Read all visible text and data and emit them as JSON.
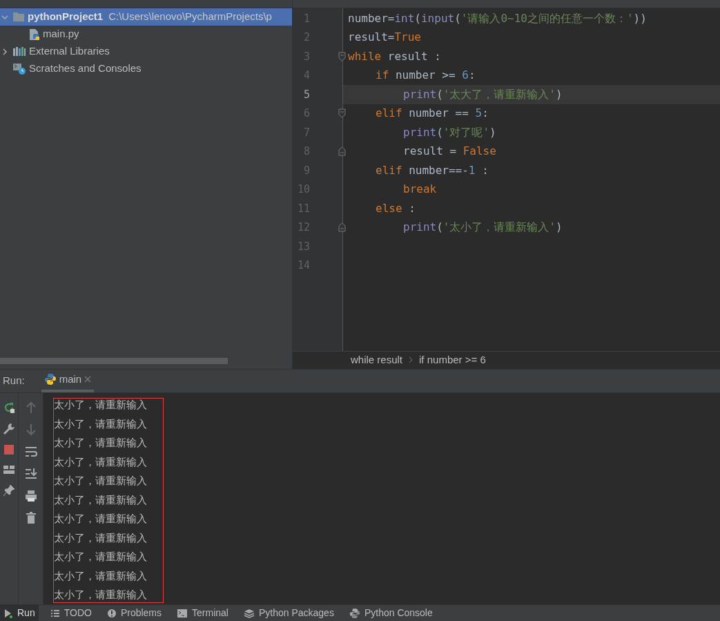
{
  "project_tree": [
    {
      "label": "pythonProject1",
      "path": "C:\\Users\\lenovo\\PycharmProjects\\p",
      "kind": "folder",
      "expanded": true,
      "selected": true,
      "children": [
        {
          "label": "main.py",
          "kind": "python",
          "selected": false
        }
      ]
    },
    {
      "label": "External Libraries",
      "kind": "library",
      "expanded": false,
      "selected": false
    },
    {
      "label": "Scratches and Consoles",
      "kind": "scratches",
      "selected": false
    }
  ],
  "editor": {
    "lines": [
      {
        "number": "1",
        "current": false,
        "tokens": [
          {
            "text": "number",
            "kind": "plain"
          },
          {
            "text": "=",
            "kind": "plain"
          },
          {
            "text": "int",
            "kind": "builtin"
          },
          {
            "text": "(",
            "kind": "plain"
          },
          {
            "text": "input",
            "kind": "builtin"
          },
          {
            "text": "(",
            "kind": "plain"
          },
          {
            "text": "'请输入0~10之间的任意一个数：'",
            "kind": "string"
          },
          {
            "text": "))",
            "kind": "plain"
          }
        ]
      },
      {
        "number": "2",
        "current": false,
        "tokens": [
          {
            "text": "result=",
            "kind": "plain"
          },
          {
            "text": "True",
            "kind": "keyword"
          }
        ]
      },
      {
        "number": "3",
        "current": false,
        "fold_start": true,
        "tokens": [
          {
            "text": "while",
            "kind": "keyword"
          },
          {
            "text": " result :",
            "kind": "plain"
          }
        ],
        "children": [
          {
            "number": "4",
            "current": false,
            "tokens": [
              {
                "text": "if",
                "kind": "keyword"
              },
              {
                "text": " number >= ",
                "kind": "plain"
              },
              {
                "text": "6",
                "kind": "number"
              },
              {
                "text": ":",
                "kind": "plain"
              }
            ],
            "children": [
              {
                "number": "5",
                "current": true,
                "tokens": [
                  {
                    "text": "print",
                    "kind": "builtin"
                  },
                  {
                    "text": "(",
                    "kind": "plain"
                  },
                  {
                    "text": "'太大了，请重新输入'",
                    "kind": "string"
                  },
                  {
                    "text": ")",
                    "kind": "plain"
                  }
                ]
              }
            ]
          },
          {
            "number": "6",
            "current": false,
            "fold_start": true,
            "tokens": [
              {
                "text": "elif",
                "kind": "keyword"
              },
              {
                "text": " number == ",
                "kind": "plain"
              },
              {
                "text": "5",
                "kind": "number"
              },
              {
                "text": ":",
                "kind": "plain"
              }
            ],
            "children": [
              {
                "number": "7",
                "current": false,
                "tokens": [
                  {
                    "text": "print",
                    "kind": "builtin"
                  },
                  {
                    "text": "(",
                    "kind": "plain"
                  },
                  {
                    "text": "'对了呢'",
                    "kind": "string"
                  },
                  {
                    "text": ")",
                    "kind": "plain"
                  }
                ]
              },
              {
                "number": "8",
                "current": false,
                "fold_end": true,
                "tokens": [
                  {
                    "text": "result = ",
                    "kind": "plain"
                  },
                  {
                    "text": "False",
                    "kind": "keyword"
                  }
                ]
              }
            ]
          },
          {
            "number": "9",
            "current": false,
            "tokens": [
              {
                "text": "elif",
                "kind": "keyword"
              },
              {
                "text": " number==-",
                "kind": "plain"
              },
              {
                "text": "1",
                "kind": "number"
              },
              {
                "text": " :",
                "kind": "plain"
              }
            ],
            "children": [
              {
                "number": "10",
                "current": false,
                "tokens": [
                  {
                    "text": "break",
                    "kind": "keyword"
                  }
                ]
              }
            ]
          },
          {
            "number": "11",
            "current": false,
            "tokens": [
              {
                "text": "else",
                "kind": "keyword"
              },
              {
                "text": " :",
                "kind": "plain"
              }
            ],
            "children": [
              {
                "number": "12",
                "current": false,
                "fold_end": true,
                "tokens": [
                  {
                    "text": "print",
                    "kind": "builtin"
                  },
                  {
                    "text": "(",
                    "kind": "plain"
                  },
                  {
                    "text": "'太小了，请重新输入'",
                    "kind": "string"
                  },
                  {
                    "text": ")",
                    "kind": "plain"
                  }
                ]
              }
            ]
          }
        ]
      },
      {
        "number": "13",
        "current": false
      },
      {
        "number": "14",
        "current": false
      }
    ],
    "breadcrumbs": [
      "while result",
      "if number >= 6"
    ]
  },
  "run": {
    "label": "Run:",
    "tab": "main"
  },
  "console_lines": [
    "太小了，请重新输入",
    "太小了，请重新输入",
    "太小了，请重新输入",
    "太小了，请重新输入",
    "太小了，请重新输入",
    "太小了，请重新输入",
    "太小了，请重新输入",
    "太小了，请重新输入",
    "太小了，请重新输入",
    "太小了，请重新输入",
    "太小了，请重新输入"
  ],
  "bottom_tabs": [
    {
      "label": "Run",
      "kind": "run",
      "selected": true
    },
    {
      "label": "TODO",
      "kind": "todo",
      "selected": false
    },
    {
      "label": "Problems",
      "kind": "problems",
      "selected": false
    },
    {
      "label": "Terminal",
      "kind": "terminal",
      "selected": false
    },
    {
      "label": "Python Packages",
      "kind": "packages",
      "selected": false
    },
    {
      "label": "Python Console",
      "kind": "console",
      "selected": false
    }
  ]
}
